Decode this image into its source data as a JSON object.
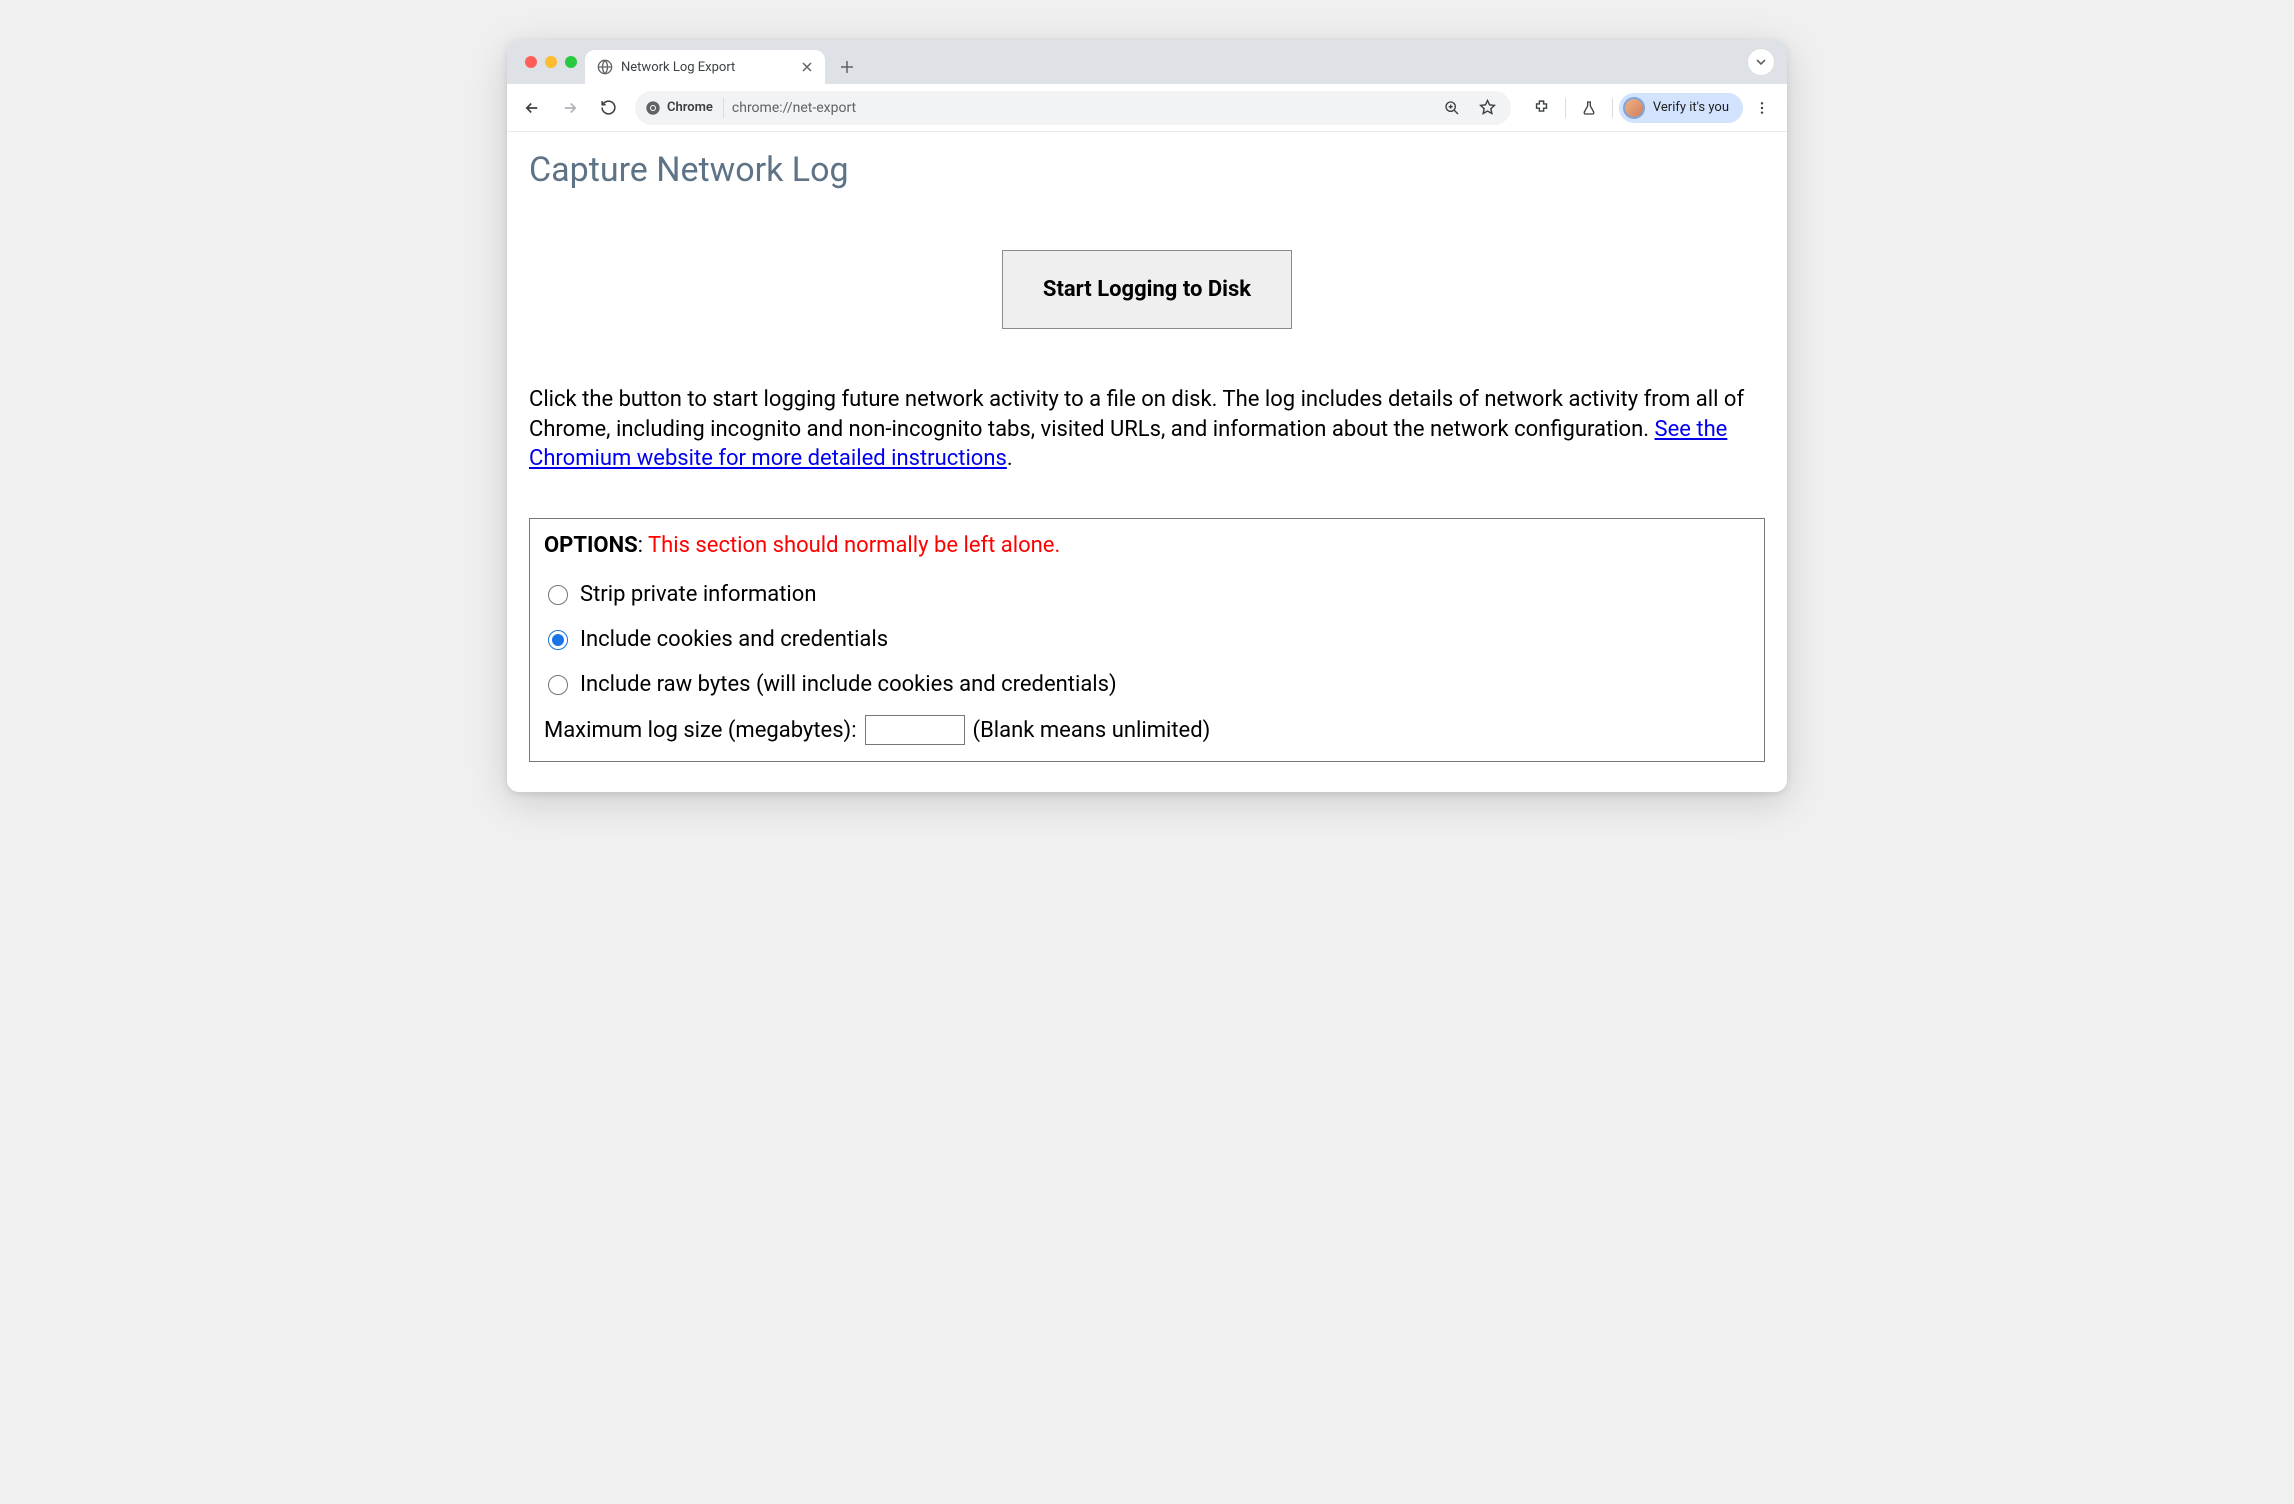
{
  "window": {
    "tab_title": "Network Log Export"
  },
  "toolbar": {
    "chrome_chip": "Chrome",
    "url": "chrome://net-export",
    "verify_label": "Verify it's you"
  },
  "page": {
    "title": "Capture Network Log",
    "start_button": "Start Logging to Disk",
    "description_pre": "Click the button to start logging future network activity to a file on disk. The log includes details of network activity from all of Chrome, including incognito and non-incognito tabs, visited URLs, and information about the network configuration. ",
    "description_link": "See the Chromium website for more detailed instructions",
    "description_post": "."
  },
  "options": {
    "header_label": "OPTIONS",
    "header_colon": ": ",
    "header_warning": "This section should normally be left alone.",
    "radios": [
      {
        "label": "Strip private information",
        "checked": false
      },
      {
        "label": "Include cookies and credentials",
        "checked": true
      },
      {
        "label": "Include raw bytes (will include cookies and credentials)",
        "checked": false
      }
    ],
    "max_label_pre": "Maximum log size (megabytes): ",
    "max_value": "",
    "max_label_post": " (Blank means unlimited)"
  }
}
